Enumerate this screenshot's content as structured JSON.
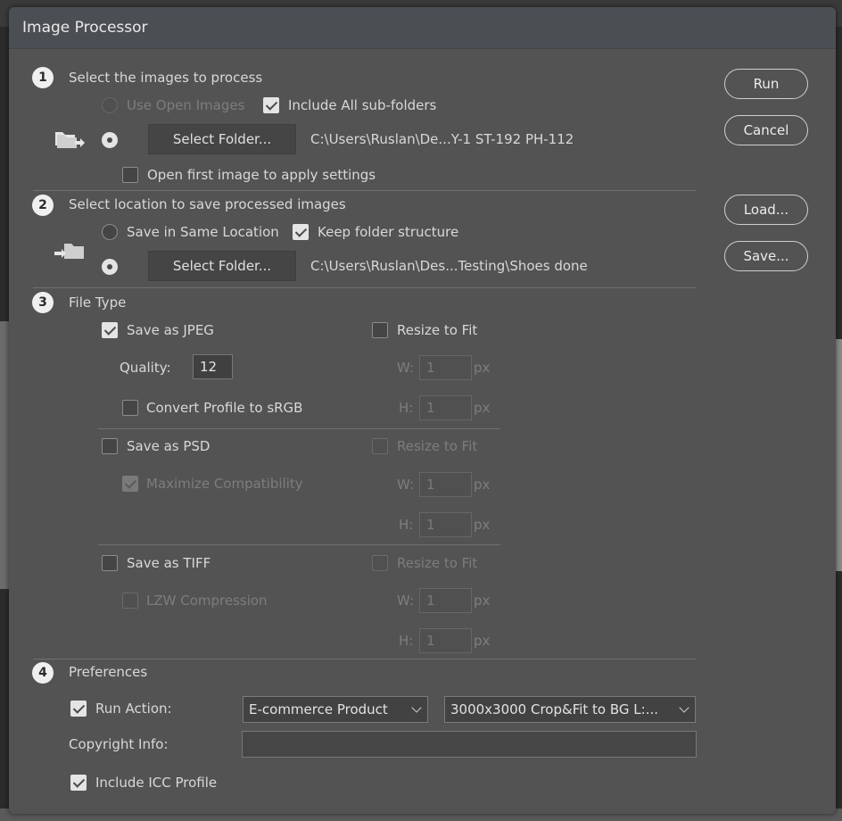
{
  "window": {
    "title": "Image Processor"
  },
  "buttons": {
    "run": "Run",
    "cancel": "Cancel",
    "load": "Load...",
    "save": "Save..."
  },
  "section1": {
    "number": "1",
    "title": "Select the images to process",
    "use_open_images": "Use Open Images",
    "include_subfolders": "Include All sub-folders",
    "select_folder": "Select Folder...",
    "folder_path": "C:\\Users\\Ruslan\\De...Y-1 ST-192 PH-112",
    "open_first_image": "Open first image to apply settings"
  },
  "section2": {
    "number": "2",
    "title": "Select location to save processed images",
    "same_location": "Save in Same Location",
    "keep_structure": "Keep folder structure",
    "select_folder": "Select Folder...",
    "folder_path": "C:\\Users\\Ruslan\\Des...Testing\\Shoes done"
  },
  "section3": {
    "number": "3",
    "title": "File Type",
    "jpeg": {
      "save_label": "Save as JPEG",
      "resize_label": "Resize to Fit",
      "quality_label": "Quality:",
      "quality_value": "12",
      "w_label": "W:",
      "w_value": "1",
      "h_label": "H:",
      "h_value": "1",
      "unit": "px",
      "convert_label": "Convert Profile to sRGB"
    },
    "psd": {
      "save_label": "Save as PSD",
      "resize_label": "Resize to Fit",
      "maximize_label": "Maximize Compatibility",
      "w_label": "W:",
      "w_value": "1",
      "h_label": "H:",
      "h_value": "1",
      "unit": "px"
    },
    "tiff": {
      "save_label": "Save as TIFF",
      "resize_label": "Resize to Fit",
      "lzw_label": "LZW Compression",
      "w_label": "W:",
      "w_value": "1",
      "h_label": "H:",
      "h_value": "1",
      "unit": "px"
    }
  },
  "section4": {
    "number": "4",
    "title": "Preferences",
    "run_action_label": "Run Action:",
    "action_set": "E-commerce Product",
    "action": "3000x3000 Crop&Fit to BG L:...",
    "copyright_label": "Copyright Info:",
    "copyright_value": "",
    "icc_label": "Include ICC Profile"
  },
  "colors": {
    "dialog_bg": "#535353",
    "titlebar_bg": "#4b4f54",
    "text": "#d8d8d8",
    "disabled_text": "#7d7d7d"
  },
  "icons": {
    "step": "numbered-circle",
    "source_folder": "folder-arrow-out-icon",
    "dest_folder": "folder-arrow-in-icon",
    "dropdown": "chevron-down-icon"
  }
}
